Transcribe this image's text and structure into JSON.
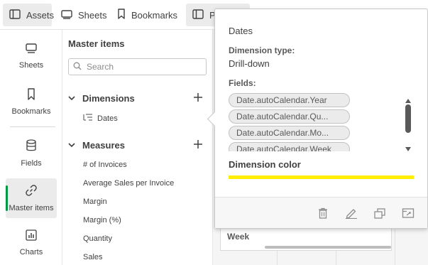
{
  "topbar": {
    "tabs": [
      {
        "label": "Assets",
        "icon": "panel-icon",
        "active": true
      },
      {
        "label": "Sheets",
        "icon": "sheet-icon"
      },
      {
        "label": "Bookmarks",
        "icon": "bookmark-icon"
      },
      {
        "label": "Pr",
        "icon": "panel-icon"
      }
    ]
  },
  "leftrail": {
    "items": [
      {
        "label": "Sheets",
        "icon": "sheet-icon"
      },
      {
        "label": "Bookmarks",
        "icon": "bookmark-icon"
      },
      {
        "label": "Fields",
        "icon": "database-icon"
      },
      {
        "label": "Master items",
        "icon": "link-icon",
        "active": true
      },
      {
        "label": "Charts",
        "icon": "bar-chart-icon"
      }
    ]
  },
  "panel": {
    "title": "Master items",
    "search_placeholder": "Search",
    "dimensions_label": "Dimensions",
    "dimension_items": [
      "Dates"
    ],
    "measures_label": "Measures",
    "measure_items": [
      "# of Invoices",
      "Average Sales per Invoice",
      "Margin",
      "Margin (%)",
      "Quantity",
      "Sales"
    ]
  },
  "canvas": {
    "week_label": "Week"
  },
  "popover": {
    "title": "Dates",
    "type_label": "Dimension type:",
    "type_value": "Drill-down",
    "fields_label": "Fields:",
    "fields": [
      "Date.autoCalendar.Year",
      "Date.autoCalendar.Qu...",
      "Date.autoCalendar.Mo...",
      "Date.autoCalendar.Week"
    ],
    "color_label": "Dimension color",
    "color_value": "#ffee00",
    "footer_icons": [
      "trash-icon",
      "edit-icon",
      "duplicate-icon",
      "open-sheet-icon"
    ]
  },
  "colors": {
    "accent_green": "#009845"
  }
}
